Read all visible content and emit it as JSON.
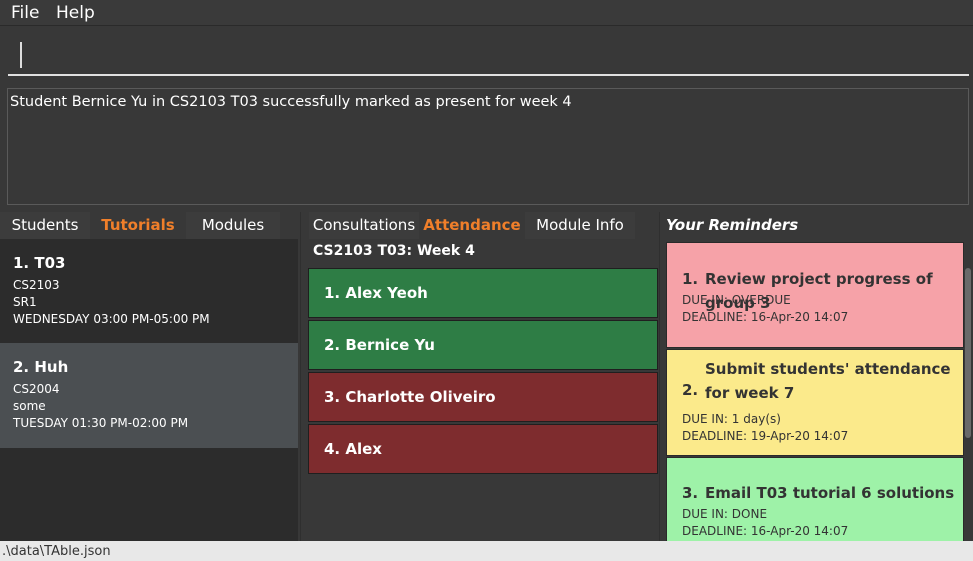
{
  "menu": [
    "File",
    "Help"
  ],
  "command_box": {
    "value": ""
  },
  "result_display": {
    "text": "Student Bernice Yu in CS2103 T03 successfully marked as present for week 4"
  },
  "left_tabs": [
    "Students",
    "Tutorials",
    "Modules"
  ],
  "left_active_tab": "Tutorials",
  "tutorials": [
    {
      "title": "1.  T03",
      "module": "CS2103",
      "venue": "SR1",
      "time": "WEDNESDAY 03:00 PM-05:00 PM"
    },
    {
      "title": "2.  Huh",
      "module": "CS2004",
      "venue": "some",
      "time": "TUESDAY 01:30 PM-02:00 PM"
    }
  ],
  "mid_tabs": [
    "Consultations",
    "Attendance",
    "Module Info"
  ],
  "mid_active_tab": "Attendance",
  "attendance": {
    "heading": "CS2103 T03: Week 4",
    "students": [
      {
        "label": "1.  Alex Yeoh",
        "status": "present"
      },
      {
        "label": "2.  Bernice Yu",
        "status": "present"
      },
      {
        "label": "3.  Charlotte Oliveiro",
        "status": "absent"
      },
      {
        "label": "4.  Alex",
        "status": "absent"
      }
    ]
  },
  "reminders": {
    "header": "Your Reminders",
    "items": [
      {
        "num": "1.",
        "title": "Review project progress of group 3",
        "due": "DUE IN: OVERDUE",
        "deadline": "DEADLINE: 16-Apr-20 14:07",
        "color": "#f6a2a8"
      },
      {
        "num": "2.",
        "title": "Submit students' attendance for week 7",
        "due": "DUE IN: 1 day(s)",
        "deadline": "DEADLINE: 19-Apr-20 14:07",
        "color": "#fbea8b"
      },
      {
        "num": "3.",
        "title": "Email T03 tutorial 6 solutions",
        "due": "DUE IN: DONE",
        "deadline": "DEADLINE: 16-Apr-20 14:07",
        "color": "#9ef2a8"
      }
    ]
  },
  "status_bar": {
    "path": ".\\data\\TAble.json"
  },
  "colors": {
    "accent": "#f07f2a",
    "present": "#2e7d45",
    "absent": "#7e2c2e"
  }
}
